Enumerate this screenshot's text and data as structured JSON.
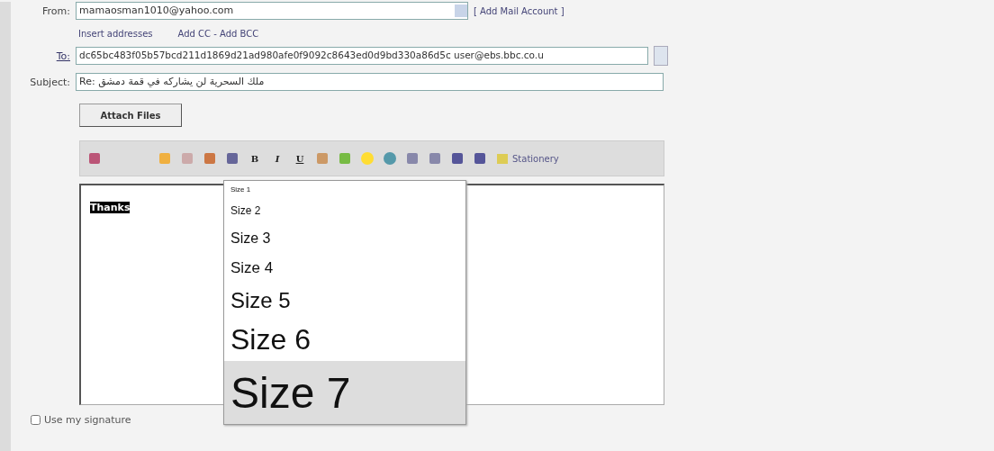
{
  "from": {
    "label": "From:",
    "value": "mamaosman1010@yahoo.com",
    "link": "[ Add Mail Account ]"
  },
  "address_links": [
    "Insert addresses",
    "Add CC - Add BCC"
  ],
  "to": {
    "label": "To:",
    "value": "dc65bc483f05b57bcd211d1869d21ad980afe0f9092c8643ed0d9bd330a86d5c user@ebs.bbc.co.u"
  },
  "subject": {
    "label": "Subject:",
    "value": "Re: ملك السحرية لن يشاركه في قمة دمشق"
  },
  "attach_button": "Attach Files",
  "toolbar": {
    "format_buttons": [
      "B",
      "I",
      "U"
    ],
    "stationery": "Stationery"
  },
  "editor": {
    "text": "Thanks",
    "text_selected": true
  },
  "size_menu": [
    {
      "label": "Size 1",
      "selected": false
    },
    {
      "label": "Size 2",
      "selected": false
    },
    {
      "label": "Size 3",
      "selected": false
    },
    {
      "label": "Size 4",
      "selected": false
    },
    {
      "label": "Size 5",
      "selected": false
    },
    {
      "label": "Size 6",
      "selected": false
    },
    {
      "label": "Size 7",
      "selected": true
    }
  ],
  "signature": {
    "label": "Use my signature",
    "checked": false
  }
}
